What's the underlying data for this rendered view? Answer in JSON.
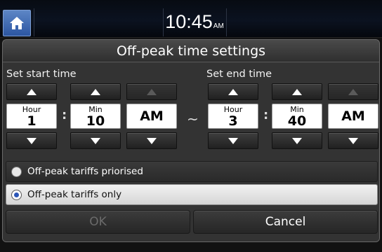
{
  "status_bar": {
    "time": "10:45",
    "ampm": "AM"
  },
  "dialog": {
    "title": "Off-peak time settings",
    "start": {
      "label": "Set start time",
      "hour_caption": "Hour",
      "hour_value": "1",
      "min_caption": "Min",
      "min_value": "10",
      "ampm_value": "AM"
    },
    "separator": "~",
    "colon": ":",
    "end": {
      "label": "Set end time",
      "hour_caption": "Hour",
      "hour_value": "3",
      "min_caption": "Min",
      "min_value": "40",
      "ampm_value": "AM"
    },
    "options": [
      {
        "label": "Off-peak tariffs priorised",
        "selected": false
      },
      {
        "label": "Off-peak tariffs only",
        "selected": true
      }
    ],
    "buttons": {
      "ok": "OK",
      "cancel": "Cancel"
    }
  },
  "colors": {
    "home_button": "#3b66b0",
    "radio_selected": "#2c56b8"
  }
}
